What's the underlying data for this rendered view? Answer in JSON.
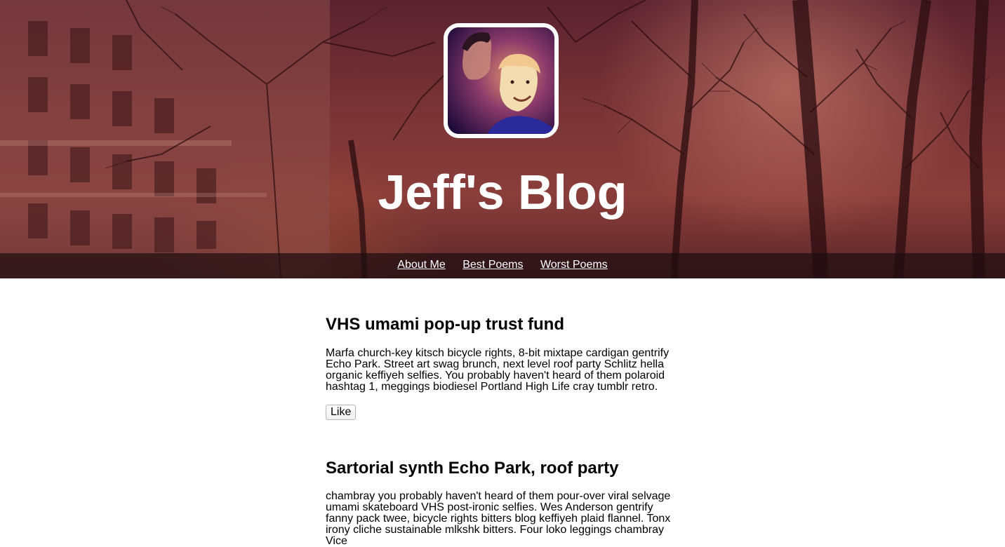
{
  "header": {
    "title": "Jeff's Blog",
    "avatar_alt": "avatar",
    "nav": [
      {
        "label": "About Me"
      },
      {
        "label": "Best Poems"
      },
      {
        "label": "Worst Poems"
      }
    ]
  },
  "posts": [
    {
      "title": "VHS umami pop-up trust fund",
      "body_lines": [
        "Marfa church-key kitsch bicycle rights, 8-bit mixtape cardigan gentrify",
        "Echo Park. Street art swag brunch, next level roof party Schlitz hella",
        "organic keffiyeh selfies. You probably haven't heard of them polaroid",
        "hashtag 1, meggings biodiesel Portland High Life cray tumblr retro."
      ],
      "like_label": "Like"
    },
    {
      "title": "Sartorial synth Echo Park, roof party",
      "body_lines": [
        "chambray you probably haven't heard of them pour-over viral selvage",
        "umami skateboard VHS post-ironic selfies. Wes Anderson gentrify",
        "fanny pack twee, bicycle rights bitters blog keffiyeh plaid flannel. Tonx",
        "irony cliche sustainable mlkshk bitters. Four loko leggings chambray",
        "Vice"
      ]
    }
  ],
  "colors": {
    "hero_tint": "#7a3436",
    "nav_bar": "#1e0e12",
    "avatar_border": "#ffffff",
    "title_text": "#ffffff"
  }
}
